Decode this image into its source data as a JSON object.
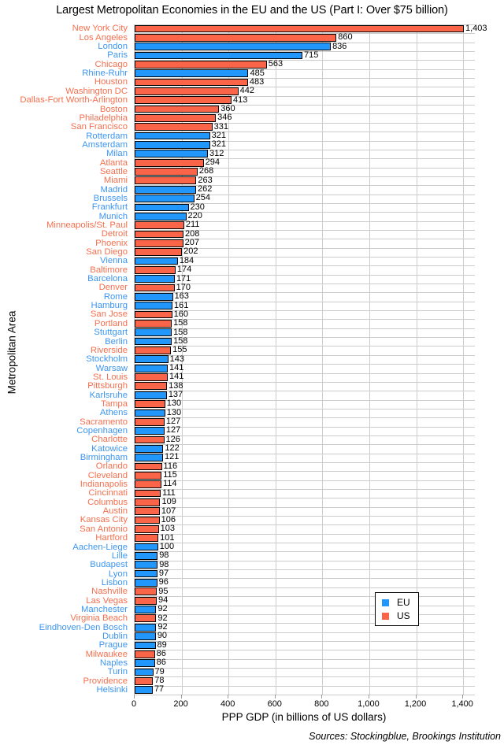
{
  "chart_data": {
    "type": "bar",
    "orientation": "horizontal",
    "title": "Largest Metropolitan Economies in the EU and the US (Part I: Over $75 billion)",
    "xlabel": "PPP GDP (in billions of US dollars)",
    "ylabel": "Metropolitan Area",
    "caption": "Sources: Stockingblue, Brookings Institution",
    "xlim": [
      0,
      1450
    ],
    "xticks": [
      0,
      200,
      400,
      600,
      800,
      1000,
      1200,
      1400
    ],
    "xtick_labels": [
      "0",
      "200",
      "400",
      "600",
      "800",
      "1,000",
      "1,200",
      "1,400"
    ],
    "grid": true,
    "legend": {
      "position": "bottom-right",
      "entries": [
        {
          "label": "EU",
          "color": "#2196fb"
        },
        {
          "label": "US",
          "color": "#fa6448"
        }
      ]
    },
    "colors": {
      "eu": "#2196fb",
      "us": "#fa6448",
      "eu_text": "#3d96f0",
      "us_text": "#f4704f"
    },
    "categories": [
      "New York City",
      "Los Angeles",
      "London",
      "Paris",
      "Chicago",
      "Rhine-Ruhr",
      "Houston",
      "Washington DC",
      "Dallas-Fort Worth-Arlington",
      "Boston",
      "Philadelphia",
      "San Francisco",
      "Rotterdam",
      "Amsterdam",
      "Milan",
      "Atlanta",
      "Seattle",
      "Miami",
      "Madrid",
      "Brussels",
      "Frankfurt",
      "Munich",
      "Minneapolis/St. Paul",
      "Detroit",
      "Phoenix",
      "San Diego",
      "Vienna",
      "Baltimore",
      "Barcelona",
      "Denver",
      "Rome",
      "Hamburg",
      "San Jose",
      "Portland",
      "Stuttgart",
      "Berlin",
      "Riverside",
      "Stockholm",
      "Warsaw",
      "St. Louis",
      "Pittsburgh",
      "Karlsruhe",
      "Tampa",
      "Athens",
      "Sacramento",
      "Copenhagen",
      "Charlotte",
      "Katowice",
      "Birmingham",
      "Orlando",
      "Cleveland",
      "Indianapolis",
      "Cincinnati",
      "Columbus",
      "Austin",
      "Kansas City",
      "San Antonio",
      "Hartford",
      "Aachen-Liege",
      "Lille",
      "Budapest",
      "Lyon",
      "Lisbon",
      "Nashville",
      "Las Vegas",
      "Manchester",
      "Virginia Beach",
      "Eindhoven-Den Bosch",
      "Dublin",
      "Prague",
      "Milwaukee",
      "Naples",
      "Turin",
      "Providence",
      "Helsinki"
    ],
    "values": [
      1403,
      860,
      836,
      715,
      563,
      485,
      483,
      442,
      413,
      360,
      346,
      331,
      321,
      321,
      312,
      294,
      268,
      263,
      262,
      254,
      230,
      220,
      211,
      208,
      207,
      202,
      184,
      174,
      171,
      170,
      163,
      161,
      160,
      158,
      158,
      158,
      155,
      143,
      141,
      141,
      138,
      137,
      130,
      130,
      127,
      127,
      126,
      122,
      121,
      116,
      115,
      114,
      111,
      109,
      107,
      106,
      103,
      101,
      100,
      98,
      98,
      97,
      96,
      95,
      94,
      92,
      92,
      92,
      90,
      89,
      86,
      86,
      79,
      78,
      77
    ],
    "value_labels": [
      "1,403",
      "860",
      "836",
      "715",
      "563",
      "485",
      "483",
      "442",
      "413",
      "360",
      "346",
      "331",
      "321",
      "321",
      "312",
      "294",
      "268",
      "263",
      "262",
      "254",
      "230",
      "220",
      "211",
      "208",
      "207",
      "202",
      "184",
      "174",
      "171",
      "170",
      "163",
      "161",
      "160",
      "158",
      "158",
      "158",
      "155",
      "143",
      "141",
      "141",
      "138",
      "137",
      "130",
      "130",
      "127",
      "127",
      "126",
      "122",
      "121",
      "116",
      "115",
      "114",
      "111",
      "109",
      "107",
      "106",
      "103",
      "101",
      "100",
      "98",
      "98",
      "97",
      "96",
      "95",
      "94",
      "92",
      "92",
      "92",
      "90",
      "89",
      "86",
      "86",
      "79",
      "78",
      "77"
    ],
    "groups": [
      "US",
      "US",
      "EU",
      "EU",
      "US",
      "EU",
      "US",
      "US",
      "US",
      "US",
      "US",
      "US",
      "EU",
      "EU",
      "EU",
      "US",
      "US",
      "US",
      "EU",
      "EU",
      "EU",
      "EU",
      "US",
      "US",
      "US",
      "US",
      "EU",
      "US",
      "EU",
      "US",
      "EU",
      "EU",
      "US",
      "US",
      "EU",
      "EU",
      "US",
      "EU",
      "EU",
      "US",
      "US",
      "EU",
      "US",
      "EU",
      "US",
      "EU",
      "US",
      "EU",
      "EU",
      "US",
      "US",
      "US",
      "US",
      "US",
      "US",
      "US",
      "US",
      "US",
      "EU",
      "EU",
      "EU",
      "EU",
      "EU",
      "US",
      "US",
      "EU",
      "US",
      "EU",
      "EU",
      "EU",
      "US",
      "EU",
      "EU",
      "US",
      "EU"
    ]
  }
}
